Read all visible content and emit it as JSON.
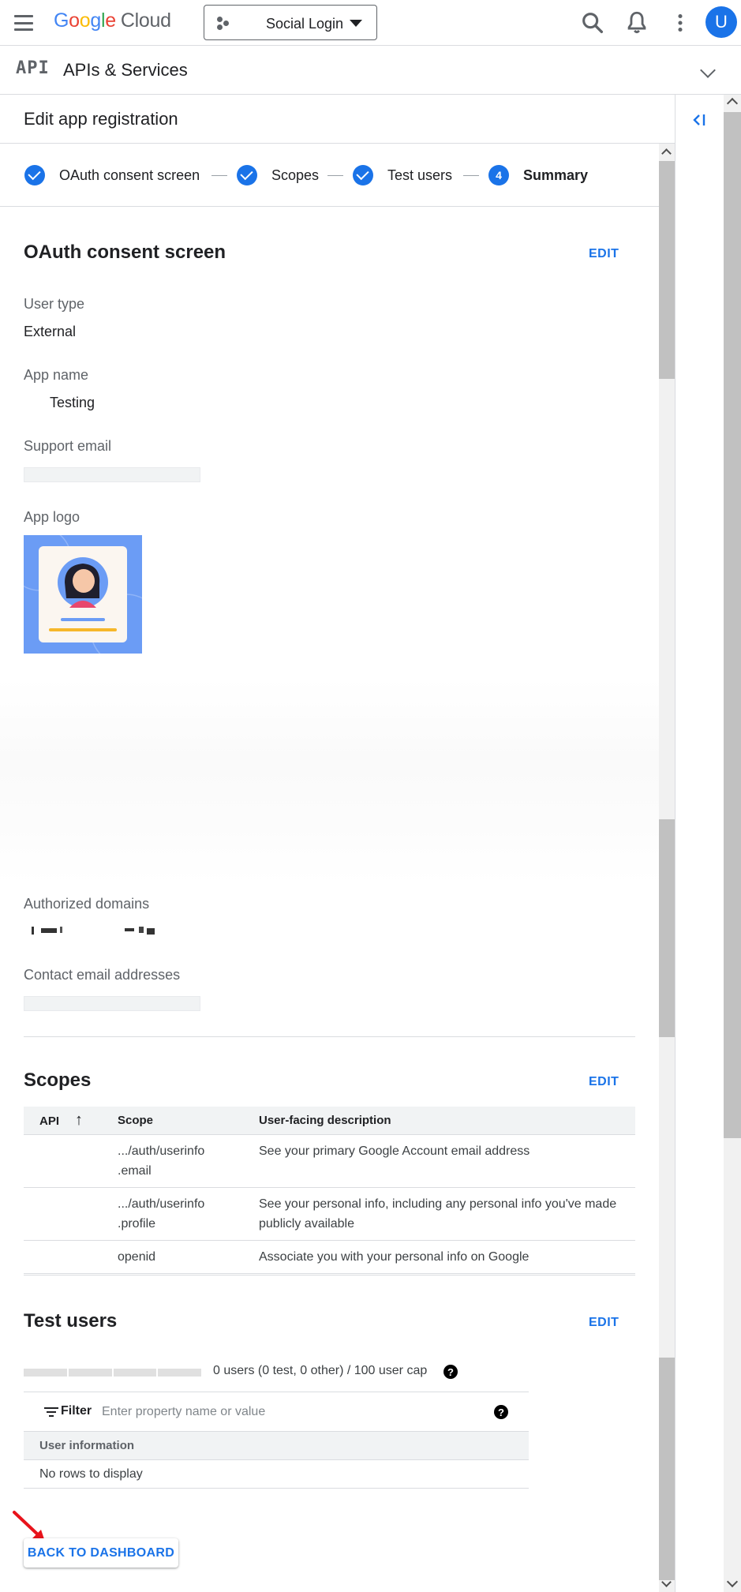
{
  "topbar": {
    "brand_google": [
      "G",
      "o",
      "o",
      "g",
      "l",
      "e"
    ],
    "brand_cloud": "Cloud",
    "project_name": "Social Login",
    "avatar_letter": "U"
  },
  "section": {
    "glyph": "API",
    "title": "APIs & Services"
  },
  "page": {
    "title": "Edit app registration"
  },
  "stepper": {
    "steps": [
      {
        "label": "OAuth consent screen",
        "state": "done"
      },
      {
        "label": "Scopes",
        "state": "done"
      },
      {
        "label": "Test users",
        "state": "done"
      },
      {
        "label": "Summary",
        "state": "current",
        "number": "4"
      }
    ]
  },
  "consent": {
    "heading": "OAuth consent screen",
    "edit": "EDIT",
    "user_type_label": "User type",
    "user_type_value": "External",
    "app_name_label": "App name",
    "app_name_value": "Testing",
    "support_email_label": "Support email",
    "app_logo_label": "App logo",
    "authorized_domains_label": "Authorized domains",
    "contact_email_label": "Contact email addresses"
  },
  "scopes": {
    "heading": "Scopes",
    "edit": "EDIT",
    "columns": [
      "API",
      "Scope",
      "User-facing description"
    ],
    "rows": [
      {
        "api": "",
        "scope_line1": ".../auth/userinfo",
        "scope_line2": ".email",
        "description": "See your primary Google Account email address"
      },
      {
        "api": "",
        "scope_line1": ".../auth/userinfo",
        "scope_line2": ".profile",
        "description": "See your personal info, including any personal info you've made publicly available"
      },
      {
        "api": "",
        "scope_line1": "openid",
        "scope_line2": "",
        "description": "Associate you with your personal info on Google"
      }
    ]
  },
  "test_users": {
    "heading": "Test users",
    "edit": "EDIT",
    "cap_text": "0 users (0 test, 0 other) / 100 user cap",
    "filter_label": "Filter",
    "filter_placeholder": "Enter property name or value",
    "column": "User information",
    "empty_text": "No rows to display",
    "help_glyph": "?"
  },
  "actions": {
    "back": "BACK TO DASHBOARD"
  },
  "colors": {
    "accent": "#1a73e8",
    "annotation_arrow": "#e8131b"
  },
  "icons": [
    "menu-icon",
    "project-icon",
    "search-icon",
    "bell-icon",
    "more-vert-icon",
    "chevron-down-icon",
    "collapse-panel-icon",
    "check-icon",
    "sort-arrow-icon",
    "filter-icon",
    "help-icon"
  ]
}
